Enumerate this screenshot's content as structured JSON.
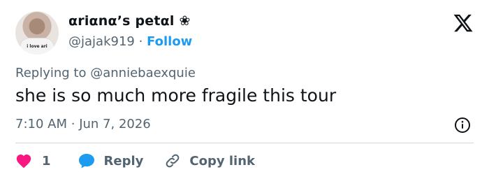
{
  "author": {
    "display_name": "αriαnα’s petαl ❀",
    "handle": "@jajak919",
    "separator": "·",
    "follow_label": "Follow",
    "avatar_shirt_text": "i love ari"
  },
  "reply_context": {
    "prefix": "Replying to",
    "mention": "@anniebaexquie"
  },
  "tweet": {
    "text": "she is so much more fragile this tour",
    "time": "7:10 AM",
    "separator": "·",
    "date": "Jun 7, 2026"
  },
  "actions": {
    "like_count": "1",
    "reply_label": "Reply",
    "copy_link_label": "Copy link"
  },
  "colors": {
    "accent": "#1d9bf0",
    "like": "#f91880",
    "secondary_text": "#536471",
    "primary_text": "#0f1419",
    "divider": "#cfd9de"
  },
  "icons": [
    "x-logo-icon",
    "info-icon",
    "heart-icon",
    "reply-bubble-icon",
    "link-icon"
  ]
}
